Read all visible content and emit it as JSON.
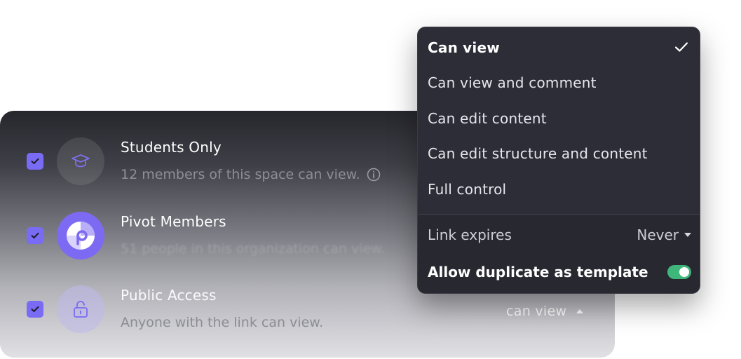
{
  "colors": {
    "accent": "#7a6bf4",
    "toggle_on": "#3fb67a",
    "menu_bg": "#2d2d37"
  },
  "access_list": [
    {
      "title": "Students Only",
      "subtitle": "12 members of this space can view.",
      "checked": true,
      "icon": "graduation-cap-icon"
    },
    {
      "title": "Pivot Members",
      "subtitle": "51 people in this organization can view.",
      "checked": true,
      "icon": "pivot-logo"
    },
    {
      "title": "Public Access",
      "subtitle": "Anyone with the link can view.",
      "checked": true,
      "icon": "lock-icon",
      "permission": "can view"
    }
  ],
  "menu": {
    "options": [
      {
        "label": "Can view",
        "selected": true
      },
      {
        "label": "Can view and comment",
        "selected": false
      },
      {
        "label": "Can edit content",
        "selected": false
      },
      {
        "label": "Can edit structure and content",
        "selected": false
      },
      {
        "label": "Full control",
        "selected": false
      }
    ],
    "link_expires": {
      "label": "Link expires",
      "value": "Never"
    },
    "allow_duplicate": {
      "label": "Allow duplicate as template",
      "enabled": true
    }
  }
}
